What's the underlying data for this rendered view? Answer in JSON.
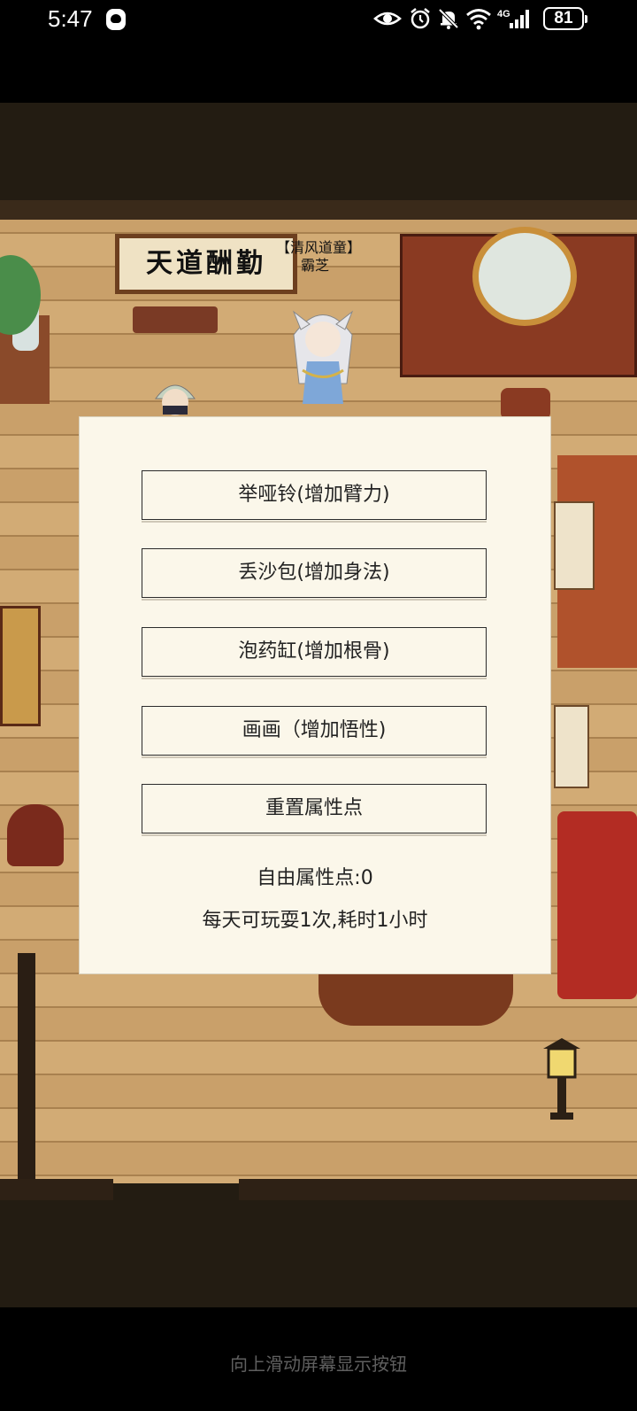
{
  "status_bar": {
    "time": "5:47",
    "battery": "81",
    "network": "4G",
    "icons": [
      "qq-icon",
      "eye-icon",
      "alarm-icon",
      "mute-icon",
      "wifi-icon",
      "signal-icon",
      "battery-icon"
    ]
  },
  "scene": {
    "sign_text": "天道酬勤",
    "npc_title": "【清风道童】",
    "npc_name": "霸芝"
  },
  "dialog": {
    "buttons": [
      "举哑铃(增加臂力)",
      "丢沙包(增加身法)",
      "泡药缸(增加根骨)",
      "画画（增加悟性)",
      "重置属性点"
    ],
    "free_points": "自由属性点:0",
    "daily_limit": "每天可玩耍1次,耗时1小时"
  },
  "gesture_hint": "向上滑动屏幕显示按钮",
  "colors": {
    "dialog_bg": "#fbf7ea",
    "button_border": "#2b2b2b",
    "floor_wood": "#c9a06a"
  }
}
